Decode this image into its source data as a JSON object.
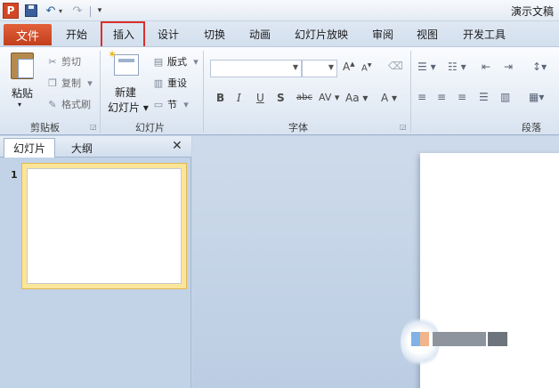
{
  "title_bar": {
    "app_icon_letter": "P",
    "document_title": "演示文稿"
  },
  "tabs": {
    "file": "文件",
    "home": "开始",
    "insert": "插入",
    "design": "设计",
    "transitions": "切换",
    "animations": "动画",
    "slideshow": "幻灯片放映",
    "review": "审阅",
    "view": "视图",
    "developer": "开发工具"
  },
  "clipboard": {
    "paste": "粘贴",
    "cut": "剪切",
    "copy": "复制",
    "format_painter": "格式刷",
    "group_label": "剪贴板"
  },
  "slides": {
    "new_slide_line1": "新建",
    "new_slide_line2": "幻灯片",
    "layout": "版式",
    "reset": "重设",
    "section": "节",
    "group_label": "幻灯片"
  },
  "font": {
    "font_name": "",
    "font_size": "",
    "bold": "B",
    "italic": "I",
    "underline": "U",
    "shadow": "S",
    "strikethrough": "abc",
    "char_spacing": "AV",
    "change_case": "Aa",
    "font_color": "A",
    "grow": "A",
    "shrink": "A",
    "group_label": "字体"
  },
  "paragraph": {
    "group_label": "段落"
  },
  "left_pane": {
    "tab_slides": "幻灯片",
    "tab_outline": "大纲",
    "thumbnails": [
      {
        "number": "1"
      }
    ]
  },
  "icons": {
    "app": "powerpoint-icon",
    "save": "save-icon",
    "undo": "undo-icon",
    "redo": "redo-icon",
    "close": "close-icon",
    "cut": "scissors-icon",
    "copy": "copy-icon",
    "format_painter": "brush-icon",
    "layout": "layout-icon",
    "reset": "reset-icon",
    "section": "section-icon"
  },
  "colors": {
    "file_tab": "#c9441f",
    "highlight_box": "#d9302c",
    "thumbnail_selected": "#fbe59a"
  }
}
